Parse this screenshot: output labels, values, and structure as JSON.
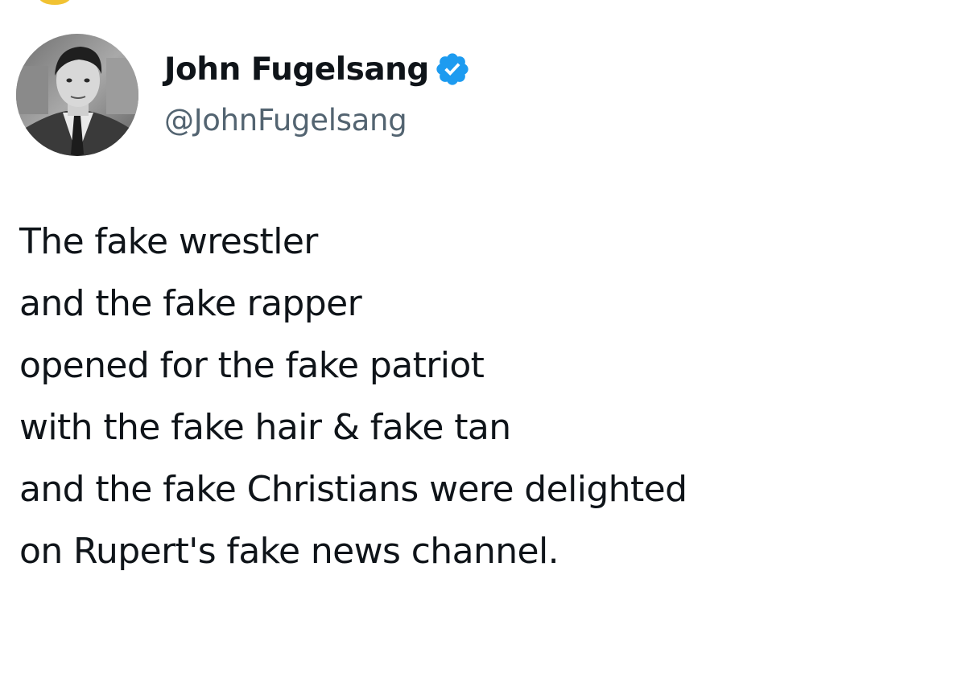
{
  "author": {
    "display_name": "John Fugelsang",
    "handle": "@JohnFugelsang",
    "verified": true,
    "avatar_icon": "profile-photo",
    "badge_icon": "verified-checkmark-icon"
  },
  "tweet": {
    "lines": [
      "The fake wrestler",
      "and the fake rapper",
      "opened for the fake patriot",
      "with the fake hair & fake tan",
      "and the fake Christians were delighted",
      "on Rupert's fake news channel."
    ]
  },
  "colors": {
    "text": "#0f1419",
    "secondary_text": "#536471",
    "verified_blue": "#1d9bf0",
    "background": "#ffffff"
  }
}
